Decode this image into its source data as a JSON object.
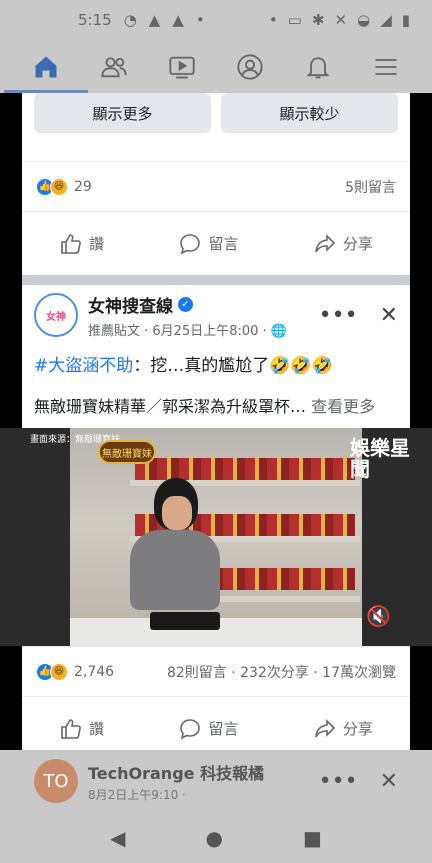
{
  "status_bar": {
    "time": "5:15"
  },
  "nav": {
    "items": [
      {
        "name": "home",
        "active": true
      },
      {
        "name": "friends",
        "active": false
      },
      {
        "name": "watch",
        "active": false
      },
      {
        "name": "profile",
        "active": false
      },
      {
        "name": "notifications",
        "active": false
      },
      {
        "name": "menu",
        "active": false
      }
    ]
  },
  "prev_post": {
    "show_more": "顯示更多",
    "show_less": "顯示較少",
    "reaction_count": "29",
    "comments": "5則留言"
  },
  "actions": {
    "like": "讚",
    "comment": "留言",
    "share": "分享"
  },
  "post": {
    "page_name": "女神搜查線",
    "avatar_text": "女神",
    "meta": "推薦貼文 · 6月25日上午8:00 ·",
    "hashtag": "#大盜涵不助",
    "text_rest": "：挖…真的尷尬了🤣🤣🤣",
    "line2": "無敵珊寶妹精華／郭采潔為升級罩杯…",
    "see_more": "查看更多",
    "video": {
      "credit": "畫面來源：無敵珊寶妹",
      "logo": "無敵珊寶妹",
      "brand": "娛樂星聞"
    },
    "reaction_count": "2,746",
    "stats": "82則留言 · 232次分享 · 17萬次瀏覽"
  },
  "next_post": {
    "avatar_text": "TO",
    "page_name": "TechOrange 科技報橘",
    "meta": "8月2日上午9:10 ·"
  },
  "colors": {
    "accent": "#1877f2",
    "overlay": "#c9c9c9"
  }
}
